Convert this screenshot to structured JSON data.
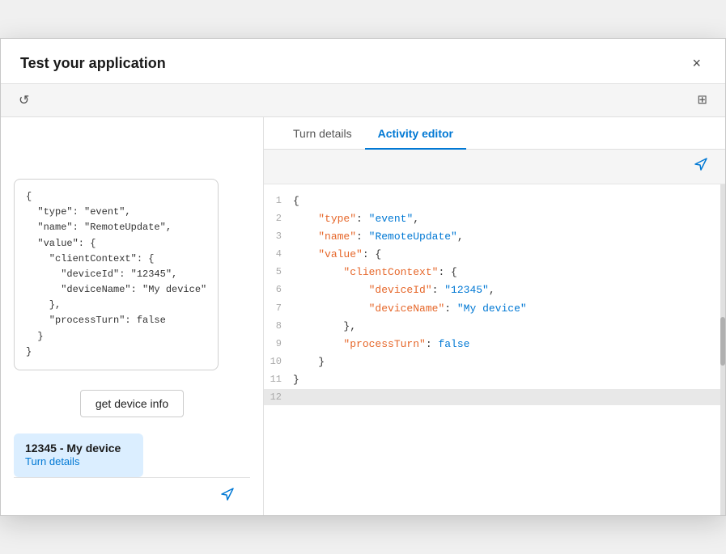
{
  "dialog": {
    "title": "Test your application",
    "close_label": "×"
  },
  "toolbar": {
    "refresh_label": "↺",
    "expand_label": "⊞"
  },
  "left_panel": {
    "json_code": "{\n  \"type\": \"event\",\n  \"name\": \"RemoteUpdate\",\n  \"value\": {\n    \"clientContext\": {\n      \"deviceId\": \"12345\",\n      \"deviceName\": \"My device\"\n    },\n    \"processTurn\": false\n  }\n}",
    "action_button": "get device info",
    "device_card": {
      "name": "12345 - My device",
      "link": "Turn details"
    }
  },
  "tabs": [
    {
      "label": "Turn details",
      "active": false
    },
    {
      "label": "Activity editor",
      "active": true
    }
  ],
  "editor": {
    "lines": [
      {
        "num": 1,
        "content": "{",
        "parts": [
          {
            "text": "{",
            "class": "c-brace"
          }
        ]
      },
      {
        "num": 2,
        "content": "    \"type\": \"event\",",
        "parts": [
          {
            "text": "    ",
            "class": ""
          },
          {
            "text": "\"type\"",
            "class": "c-key"
          },
          {
            "text": ": ",
            "class": ""
          },
          {
            "text": "\"event\"",
            "class": "c-str"
          },
          {
            "text": ",",
            "class": ""
          }
        ]
      },
      {
        "num": 3,
        "content": "    \"name\": \"RemoteUpdate\",",
        "parts": [
          {
            "text": "    ",
            "class": ""
          },
          {
            "text": "\"name\"",
            "class": "c-key"
          },
          {
            "text": ": ",
            "class": ""
          },
          {
            "text": "\"RemoteUpdate\"",
            "class": "c-str"
          },
          {
            "text": ",",
            "class": ""
          }
        ]
      },
      {
        "num": 4,
        "content": "    \"value\": {",
        "parts": [
          {
            "text": "    ",
            "class": ""
          },
          {
            "text": "\"value\"",
            "class": "c-key"
          },
          {
            "text": ": {",
            "class": ""
          }
        ]
      },
      {
        "num": 5,
        "content": "        \"clientContext\": {",
        "parts": [
          {
            "text": "        ",
            "class": ""
          },
          {
            "text": "\"clientContext\"",
            "class": "c-key"
          },
          {
            "text": ": {",
            "class": ""
          }
        ]
      },
      {
        "num": 6,
        "content": "            \"deviceId\": \"12345\",",
        "parts": [
          {
            "text": "            ",
            "class": ""
          },
          {
            "text": "\"deviceId\"",
            "class": "c-key"
          },
          {
            "text": ": ",
            "class": ""
          },
          {
            "text": "\"12345\"",
            "class": "c-str"
          },
          {
            "text": ",",
            "class": ""
          }
        ]
      },
      {
        "num": 7,
        "content": "            \"deviceName\": \"My device\"",
        "parts": [
          {
            "text": "            ",
            "class": ""
          },
          {
            "text": "\"deviceName\"",
            "class": "c-key"
          },
          {
            "text": ": ",
            "class": ""
          },
          {
            "text": "\"My device\"",
            "class": "c-str"
          }
        ]
      },
      {
        "num": 8,
        "content": "        },",
        "parts": [
          {
            "text": "        },",
            "class": "c-brace"
          }
        ]
      },
      {
        "num": 9,
        "content": "        \"processTurn\": false",
        "parts": [
          {
            "text": "        ",
            "class": ""
          },
          {
            "text": "\"processTurn\"",
            "class": "c-key"
          },
          {
            "text": ": ",
            "class": ""
          },
          {
            "text": "false",
            "class": "c-bool"
          }
        ]
      },
      {
        "num": 10,
        "content": "    }",
        "parts": [
          {
            "text": "    }",
            "class": "c-brace"
          }
        ]
      },
      {
        "num": 11,
        "content": "}",
        "parts": [
          {
            "text": "}",
            "class": "c-brace"
          }
        ]
      },
      {
        "num": 12,
        "content": "",
        "parts": [],
        "last": true
      }
    ]
  }
}
